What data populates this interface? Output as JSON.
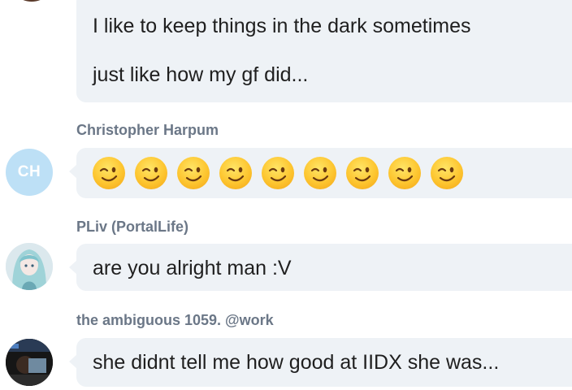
{
  "messages": [
    {
      "lines": [
        "I like to keep things in the dark sometimes",
        "just like how my gf did..."
      ]
    },
    {
      "sender": "Christopher Harpum",
      "avatar_initials": "CH",
      "emoji_icon": "winking-face-icon",
      "emoji_count": 9
    },
    {
      "sender": "PLiv (PortalLife)",
      "text": "are you alright man :V"
    },
    {
      "sender": "the ambiguous 1059. @work",
      "text": "she didnt tell me how good at IIDX she was..."
    }
  ],
  "colors": {
    "bubble": "#eef2f6",
    "sender_name": "#6b7787",
    "initials_avatar": "#bde0f6"
  }
}
